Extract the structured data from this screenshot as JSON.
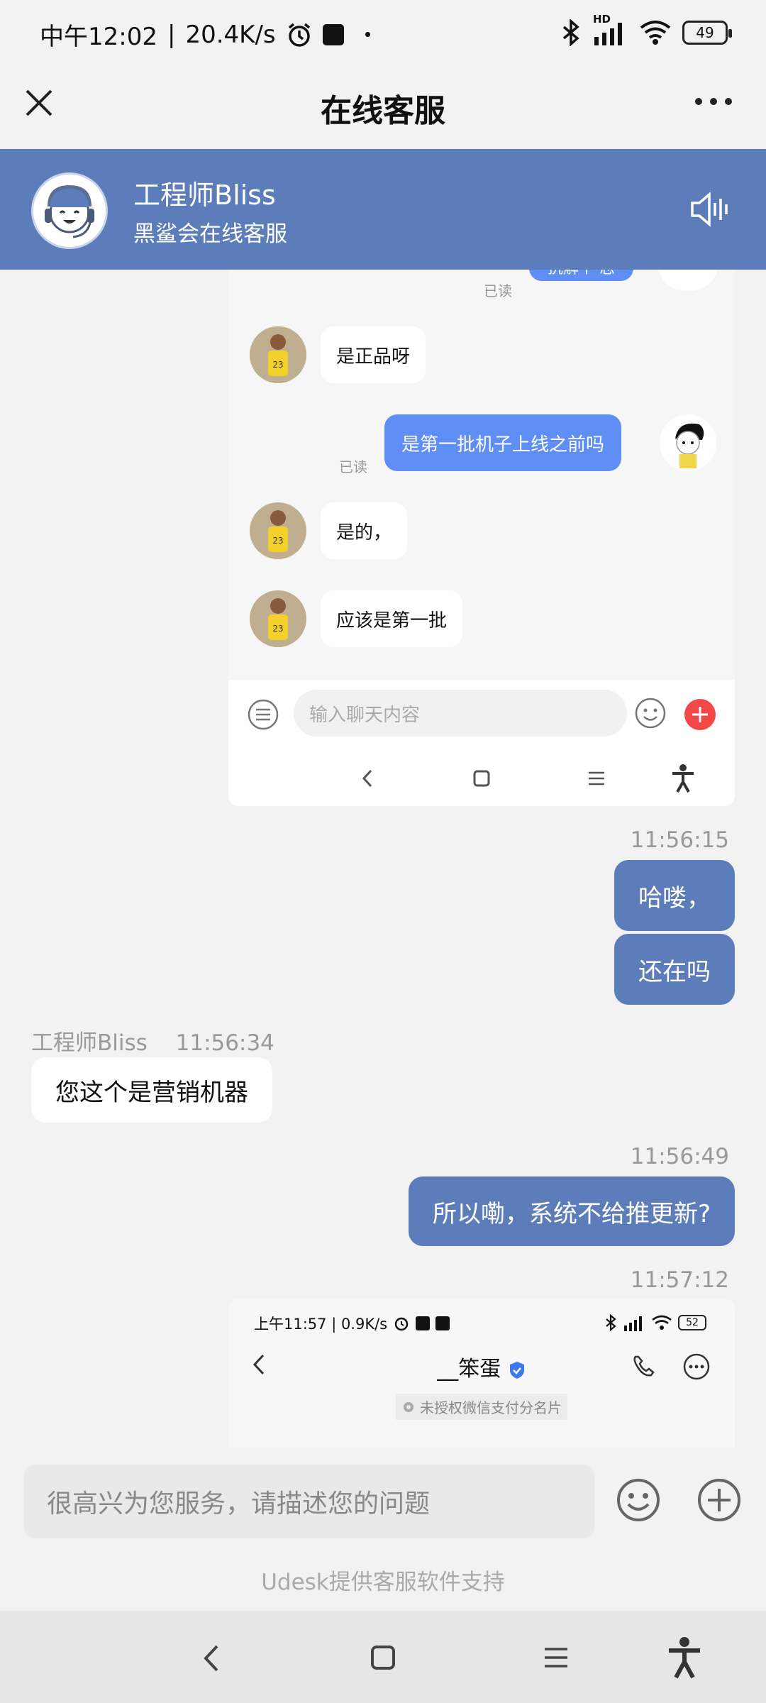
{
  "status_bar": {
    "time": "中午12:02",
    "speed": "20.4K/s",
    "battery": "49",
    "network": "HD"
  },
  "title_bar": {
    "title": "在线客服",
    "close_icon": "close-icon",
    "more_icon": "more-icon"
  },
  "agent": {
    "name": "工程师Bliss",
    "subtitle": "黑鲨会在线客服",
    "speaker_icon": "speaker-icon"
  },
  "shot1": {
    "top_bubble": "抗解个 志",
    "top_read": "已读",
    "messages": [
      {
        "side": "in",
        "text": "是正品呀"
      },
      {
        "side": "out",
        "text": "是第一批机子上线之前吗",
        "read": "已读"
      },
      {
        "side": "in",
        "text": "是的，"
      },
      {
        "side": "in",
        "text": "应该是第一批"
      }
    ],
    "input_placeholder": "输入聊天内容"
  },
  "chat": {
    "t1": "11:56:15",
    "out1": "哈喽，",
    "out2": "还在吗",
    "agent_label": "工程师Bliss",
    "t2": "11:56:34",
    "in1": "您这个是营销机器",
    "t3": "11:56:49",
    "out3": "所以嘞，系统不给推更新?",
    "t4": "11:57:12"
  },
  "shot2": {
    "status": "上午11:57 | 0.9K/s",
    "battery": "52",
    "contact": "__笨蛋",
    "notice": "未授权微信支付分名片"
  },
  "composer": {
    "placeholder": "很高兴为您服务，请描述您的问题"
  },
  "footer": {
    "text": "Udesk提供客服软件支持"
  },
  "colors": {
    "brand": "#5c7dba",
    "inner_bubble": "#5f8ff4",
    "add_button": "#f24848"
  }
}
